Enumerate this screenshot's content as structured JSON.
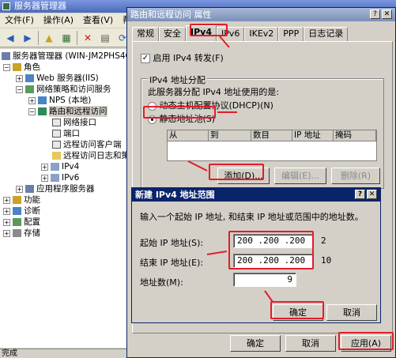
{
  "server_manager": {
    "title": "服务器管理器",
    "menu": [
      "文件(F)",
      "操作(A)",
      "查看(V)",
      "帮"
    ],
    "tree": [
      {
        "label": "服务器管理器 (WIN-JM2PHS4CAT",
        "expander": ""
      },
      {
        "label": "角色",
        "expander": "−"
      },
      {
        "label": "Web 服务器(IIS)",
        "expander": "+"
      },
      {
        "label": "网络策略和访问服务",
        "expander": "−"
      },
      {
        "label": "NPS (本地)",
        "expander": "+"
      },
      {
        "label": "路由和远程访问",
        "expander": "−"
      },
      {
        "label": "网络接口",
        "expander": ""
      },
      {
        "label": "端口",
        "expander": ""
      },
      {
        "label": "远程访问客户端",
        "expander": ""
      },
      {
        "label": "远程访问日志和策",
        "expander": ""
      },
      {
        "label": "IPv4",
        "expander": "+"
      },
      {
        "label": "IPv6",
        "expander": "+"
      },
      {
        "label": "应用程序服务器",
        "expander": "+"
      },
      {
        "label": "功能",
        "expander": "+"
      },
      {
        "label": "诊断",
        "expander": "+"
      },
      {
        "label": "配置",
        "expander": "+"
      },
      {
        "label": "存储",
        "expander": "+"
      }
    ],
    "status": "完成"
  },
  "properties_dialog": {
    "title": "路由和远程访问 属性",
    "tabs": [
      "常规",
      "安全",
      "IPv4",
      "IPv6",
      "IKEv2",
      "PPP",
      "日志记录"
    ],
    "active_tab": "IPv4",
    "enable_forwarding_label": "启用 IPv4 转发(F)",
    "enable_forwarding_checked": true,
    "group_label": "IPv4 地址分配",
    "group_desc": "此服务器分配 IPv4 地址使用的是:",
    "dhcp_label": "动态主机配置协议(DHCP)(N)",
    "static_label": "静态地址池(S)",
    "static_selected": true,
    "columns": [
      "从",
      "到",
      "数目",
      "IP 地址",
      "掩码"
    ],
    "add_button": "添加(D)...",
    "edit_button": "编辑(E)...",
    "delete_button": "删除(R)",
    "ok_button": "确定",
    "cancel_button": "取消",
    "apply_button": "应用(A)"
  },
  "range_dialog": {
    "title": "新建 IPv4 地址范围",
    "instructions": "输入一个起始 IP 地址, 和结束 IP 地址或范围中的地址数。",
    "start_label": "起始 IP 地址(S):",
    "start_ip": "200 .200 .200 . 2",
    "end_label": "结束 IP 地址(E):",
    "end_ip": "200 .200 .200 . 10",
    "count_label": "地址数(M):",
    "count_value": "9",
    "ok_button": "确定",
    "cancel_button": "取消"
  },
  "colors": {
    "highlight_red": "#e21d2a",
    "title_active": "#0a246a",
    "title_inactive": "#7b8fb8"
  }
}
